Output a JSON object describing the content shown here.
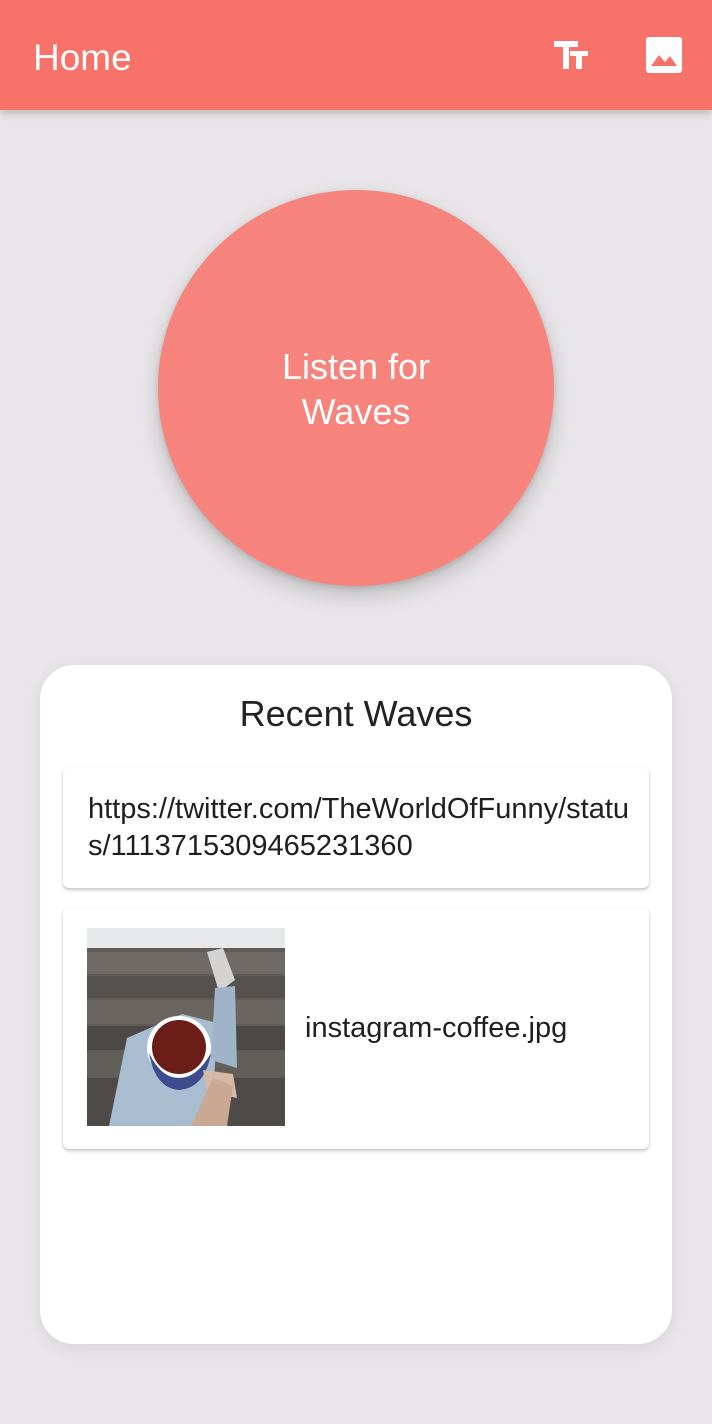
{
  "app_bar": {
    "title": "Home",
    "background": "#f7736a",
    "actions": [
      {
        "icon": "text-size-icon"
      },
      {
        "icon": "image-icon"
      }
    ]
  },
  "listen": {
    "label": "Listen for Waves",
    "color": "#f6847d"
  },
  "recent": {
    "title": "Recent Waves",
    "items": [
      {
        "type": "link",
        "text": "https://twitter.com/TheWorldOfFunny/status/1113715309465231360"
      },
      {
        "type": "image",
        "thumbnail_icon": "photo-thumbnail",
        "text": "instagram-coffee.jpg"
      }
    ]
  }
}
